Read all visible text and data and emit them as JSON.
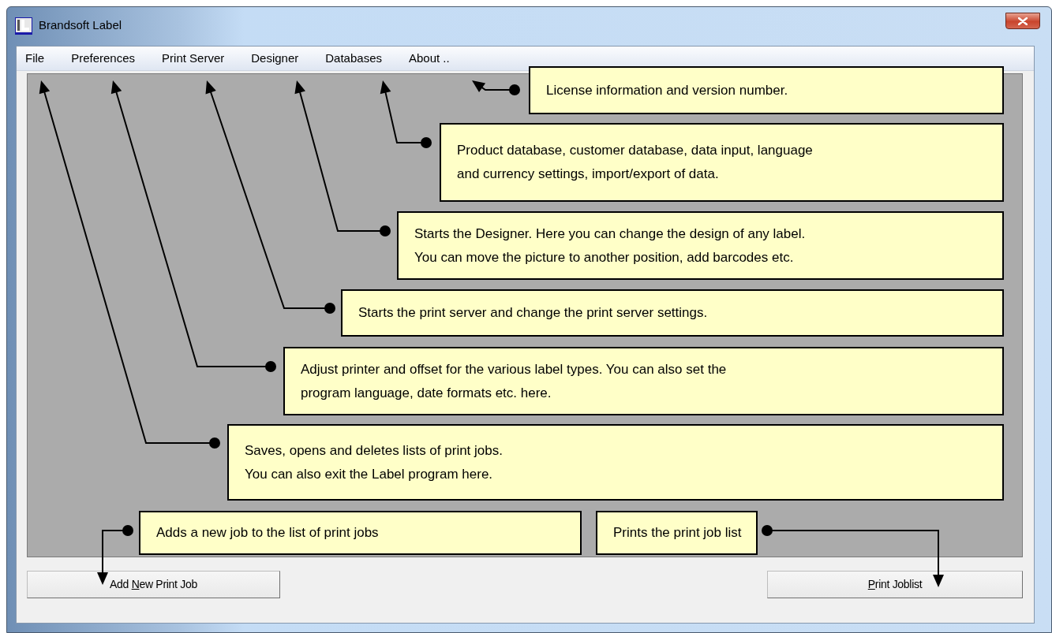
{
  "window": {
    "title": "Brandsoft Label"
  },
  "menu": [
    {
      "label": "File"
    },
    {
      "label": "Preferences"
    },
    {
      "label": "Print Server"
    },
    {
      "label": "Designer"
    },
    {
      "label": "Databases"
    },
    {
      "label": "About .."
    }
  ],
  "callouts": [
    {
      "lines": [
        "License information and version number."
      ]
    },
    {
      "lines": [
        "Product database, customer database, data input, language",
        "and currency settings, import/export of data."
      ]
    },
    {
      "lines": [
        "Starts the Designer. Here you can change the design of any label.",
        "You can move the picture to another position, add barcodes etc."
      ]
    },
    {
      "lines": [
        "Starts the print server and change the print server settings."
      ]
    },
    {
      "lines": [
        "Adjust printer and offset for the various label types. You can also set the",
        "program language, date formats etc. here."
      ]
    },
    {
      "lines": [
        "Saves, opens and deletes lists of print jobs.",
        "You can also exit the Label program here."
      ]
    },
    {
      "lines": [
        "Adds a new job to the list of print jobs"
      ]
    },
    {
      "lines": [
        "Prints the print job list"
      ]
    }
  ],
  "buttons": [
    {
      "before": "Add ",
      "key": "N",
      "after": "ew Print Job"
    },
    {
      "key": "P",
      "after": "rint Joblist"
    }
  ]
}
